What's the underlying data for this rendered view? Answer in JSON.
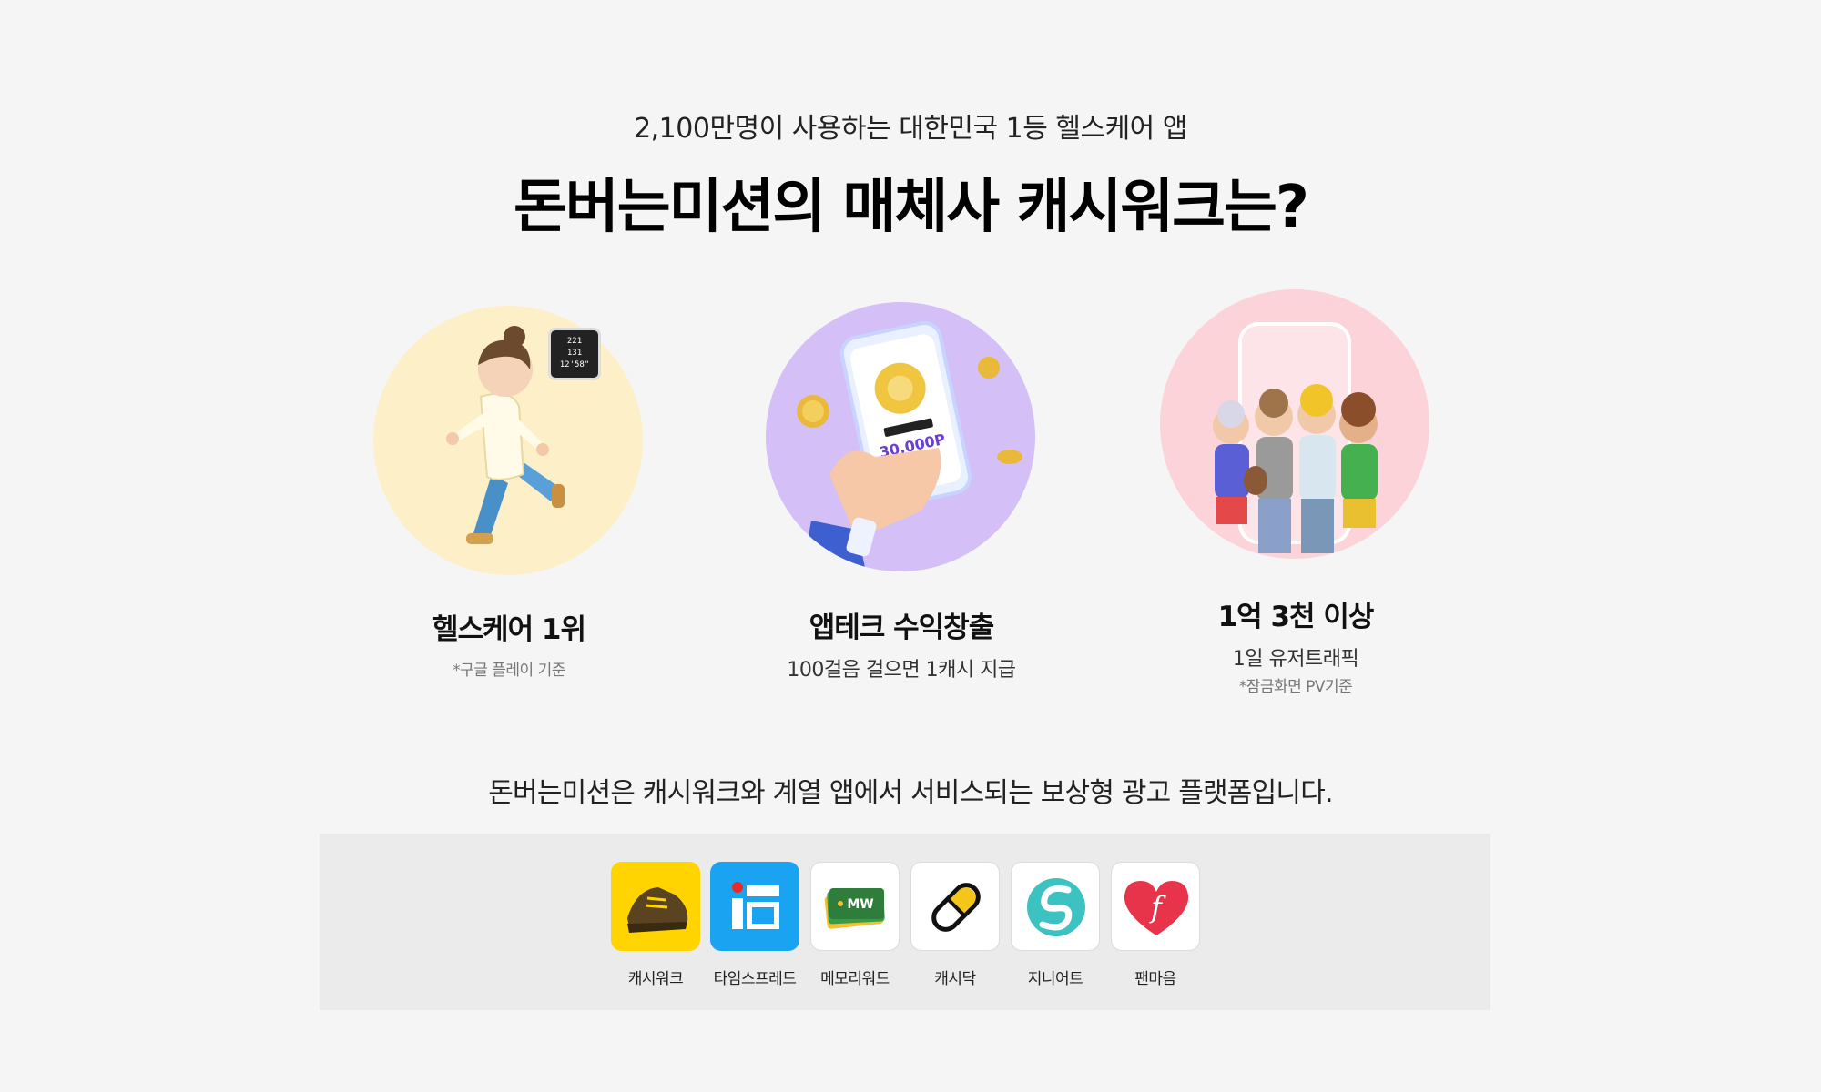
{
  "header": {
    "subtitle": "2,100만명이 사용하는 대한민국 1등 헬스케어 앱",
    "title": "돈버는미션의 매체사 캐시워크는?"
  },
  "features": [
    {
      "title": "헬스케어 1위",
      "note": "*구글 플레이 기준",
      "icon": "running-person-illustration",
      "circle_color": "#fdefc8"
    },
    {
      "title": "앱테크 수익창출",
      "desc": "100걸음 걸으면 1캐시 지급",
      "icon": "phone-reward-illustration",
      "circle_color": "#d4bff7",
      "phone": {
        "badge": "30,000P"
      }
    },
    {
      "title": "1억 3천 이상",
      "desc": "1일 유저트래픽",
      "note": "*잠금화면 PV기준",
      "icon": "group-of-friends-illustration",
      "circle_color": "#fbd3d8"
    }
  ],
  "watch": {
    "line1": "221",
    "line2": "131",
    "line3": "12'58\""
  },
  "intro": "돈버는미션은 캐시워크와 계열 앱에서 서비스되는 보상형 광고 플랫폼입니다.",
  "apps": [
    {
      "label": "캐시워크",
      "icon": "shoe-icon",
      "bg": "#ffd400"
    },
    {
      "label": "타임스프레드",
      "icon": "timespread-icon",
      "bg": "#1aa3f0"
    },
    {
      "label": "메모리워드",
      "icon": "memory-cards-icon",
      "bg": "#ffffff"
    },
    {
      "label": "캐시닥",
      "icon": "pill-icon",
      "bg": "#ffffff"
    },
    {
      "label": "지니어트",
      "icon": "genieat-s-icon",
      "bg": "#ffffff"
    },
    {
      "label": "팬마음",
      "icon": "heart-f-icon",
      "bg": "#ffffff"
    }
  ]
}
